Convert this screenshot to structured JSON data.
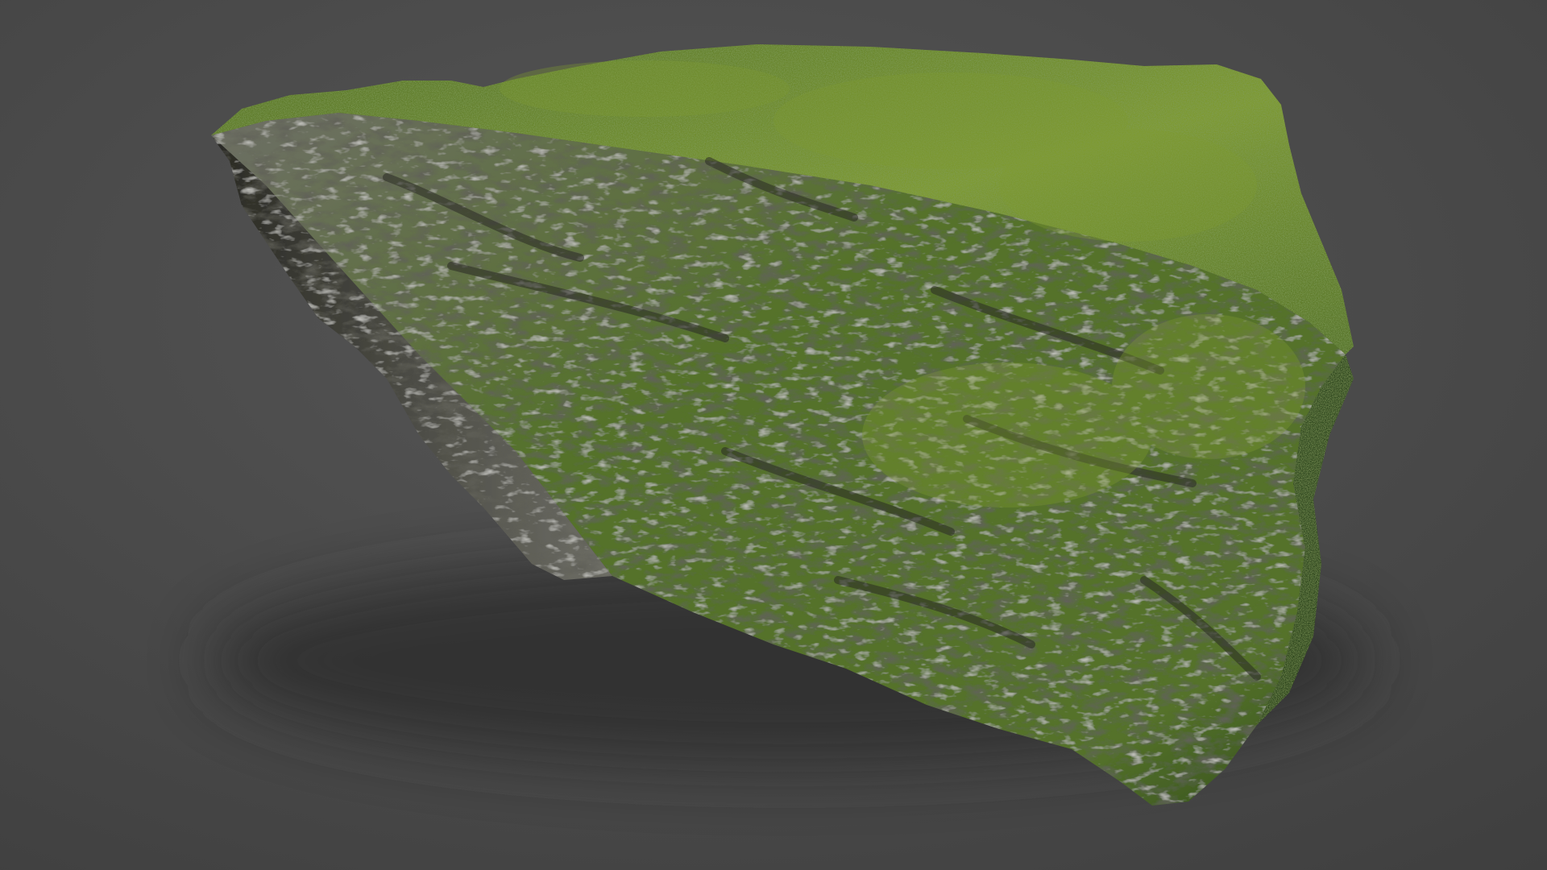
{
  "scene": {
    "subject": "moss-covered-rock",
    "colors": {
      "background_light": "#565656",
      "background_dark": "#3f3f3f",
      "shadow": "#2c2c2c",
      "moss_bright": "#7e9a32",
      "moss_mid": "#55722a",
      "moss_dark": "#2f4a1d",
      "rock_dark": "#2a2a24",
      "rock_grey": "#6e6e66",
      "rock_light": "#9a9a92"
    }
  }
}
